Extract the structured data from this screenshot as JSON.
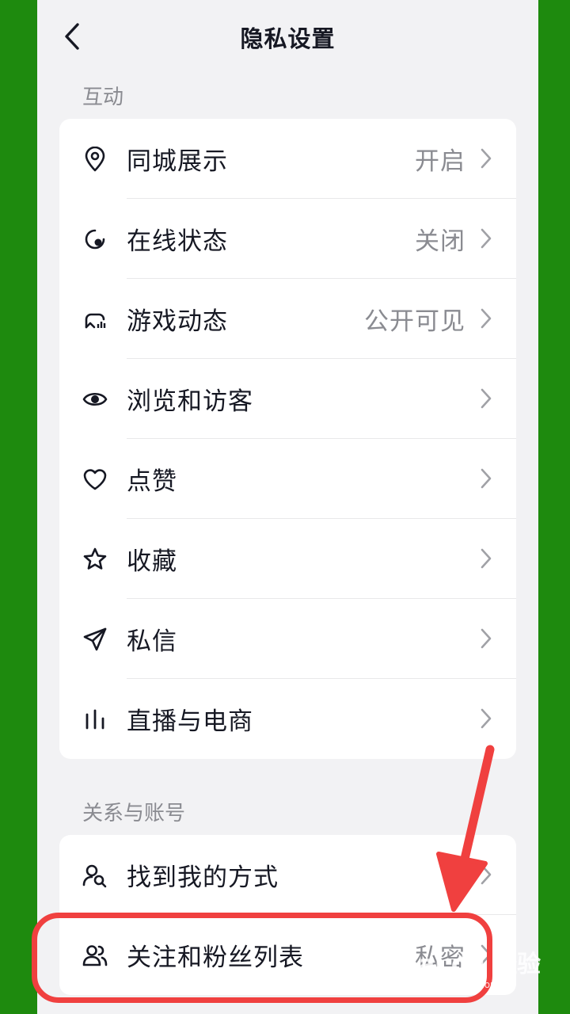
{
  "header": {
    "title": "隐私设置",
    "back_icon": "chevron-left-icon"
  },
  "sections": [
    {
      "label": "互动",
      "items": [
        {
          "label": "同城展示",
          "value": "开启",
          "icon": "location-pin-icon"
        },
        {
          "label": "在线状态",
          "value": "关闭",
          "icon": "online-status-icon"
        },
        {
          "label": "游戏动态",
          "value": "公开可见",
          "icon": "game-controller-icon"
        },
        {
          "label": "浏览和访客",
          "value": "",
          "icon": "eye-icon"
        },
        {
          "label": "点赞",
          "value": "",
          "icon": "heart-icon"
        },
        {
          "label": "收藏",
          "value": "",
          "icon": "star-icon"
        },
        {
          "label": "私信",
          "value": "",
          "icon": "send-icon"
        },
        {
          "label": "直播与电商",
          "value": "",
          "icon": "bar-chart-icon"
        }
      ]
    },
    {
      "label": "关系与账号",
      "items": [
        {
          "label": "找到我的方式",
          "value": "",
          "icon": "user-search-icon"
        },
        {
          "label": "关注和粉丝列表",
          "value": "私密",
          "icon": "users-icon"
        }
      ]
    }
  ],
  "annotation": {
    "color": "#f0403f"
  },
  "watermark": {
    "main": "Bai du 经验",
    "sub": "jingyan.baidu.com"
  }
}
